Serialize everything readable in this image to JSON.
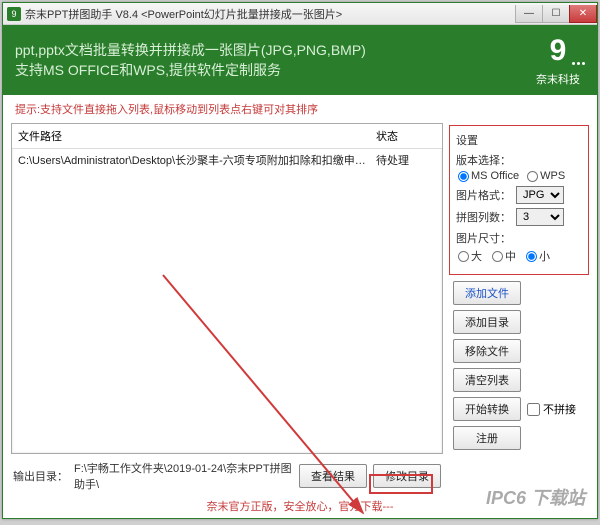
{
  "titlebar": {
    "icon_text": "9",
    "title": "奈末PPT拼图助手 V8.4 <PowerPoint幻灯片批量拼接成一张图片>"
  },
  "header": {
    "line1": "ppt,pptx文档批量转换并拼接成一张图片(JPG,PNG,BMP)",
    "line2": "支持MS OFFICE和WPS,提供软件定制服务",
    "brand": "奈末科技"
  },
  "hint": "提示:支持文件直接拖入列表,鼠标移动到列表点右键可对其排序",
  "list": {
    "col_path": "文件路径",
    "col_status": "状态",
    "rows": [
      {
        "path": "C:\\Users\\Administrator\\Desktop\\长沙聚丰-六项专项附加扣除和扣缴申报操作指…",
        "status": "待处理"
      }
    ]
  },
  "output": {
    "label": "输出目录：",
    "path": "F:\\宇畅工作文件夹\\2019-01-24\\奈末PPT拼图助手\\",
    "view_result": "查看结果",
    "modify_dir": "修改目录"
  },
  "settings": {
    "title": "设置",
    "version_label": "版本选择：",
    "version_ms": "MS Office",
    "version_wps": "WPS",
    "format_label": "图片格式：",
    "format_value": "JPG",
    "cols_label": "拼图列数：",
    "cols_value": "3",
    "size_label": "图片尺寸：",
    "size_large": "大",
    "size_medium": "中",
    "size_small": "小"
  },
  "buttons": {
    "add_file": "添加文件",
    "add_dir": "添加目录",
    "remove_file": "移除文件",
    "clear_list": "清空列表",
    "start": "开始转换",
    "no_join": "不拼接",
    "register": "注册"
  },
  "footer": {
    "text_prefix": "奈末官方正版，安全放心，官方下载---",
    "link": ""
  },
  "watermark": "IPC6 下载站"
}
